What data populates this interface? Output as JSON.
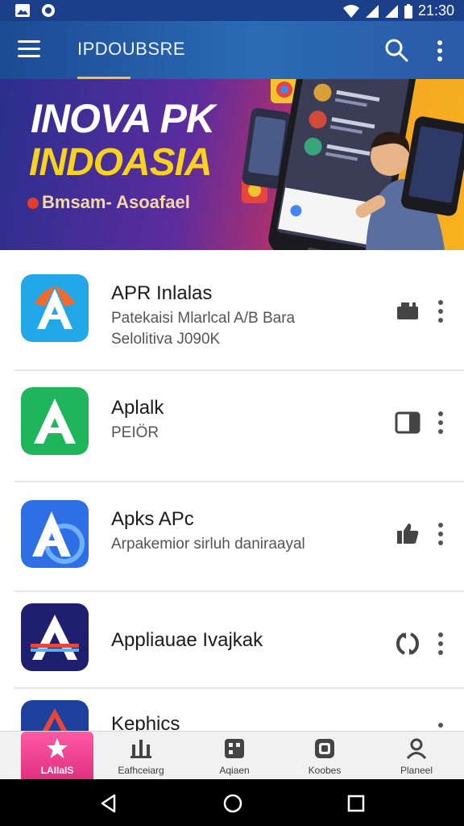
{
  "status_bar": {
    "time": "21:30",
    "icons": [
      "gallery-icon",
      "app-icon",
      "wifi-icon",
      "signal-icon",
      "signal-icon",
      "battery-icon"
    ]
  },
  "app_bar": {
    "title": "IPDOUBSRE",
    "icons": [
      "menu-icon",
      "search-icon",
      "more-vert-icon"
    ]
  },
  "banner": {
    "line1": "INOVA PK",
    "line2": "INDOASIA",
    "subtitle": "Bmsam- Asoafael"
  },
  "apps": [
    {
      "name": "APR Inlalas",
      "description": "Patekaisi Mlarlcal A/B Bara\nSelolitiva J090K",
      "icon_color": "#22a7e8",
      "action_icon": "cast-icon"
    },
    {
      "name": "Aplalk",
      "description": "PEIÖR",
      "icon_color": "#1fb55a",
      "action_icon": "tablet-icon"
    },
    {
      "name": "Apks APc",
      "description": "Arpakemior sirluh daniraayal",
      "icon_color": "#2f6fe6",
      "action_icon": "thumbs-up-icon"
    },
    {
      "name": "Appliauae Ivajkak",
      "description": "",
      "icon_color": "#1e1f6e",
      "action_icon": "sync-icon"
    },
    {
      "name": "Kephics",
      "description": "",
      "icon_color": "#1d3f9e",
      "action_icon": ""
    }
  ],
  "bottom_nav": [
    {
      "label": "LAIIaIS",
      "icon": "star-icon",
      "active": true
    },
    {
      "label": "Eafhceiarg",
      "icon": "building-icon",
      "active": false
    },
    {
      "label": "Aqiaen",
      "icon": "grid-icon",
      "active": false
    },
    {
      "label": "Koobes",
      "icon": "book-icon",
      "active": false
    },
    {
      "label": "Planeel",
      "icon": "person-icon",
      "active": false
    }
  ],
  "system_nav": [
    "back-icon",
    "home-icon",
    "recents-icon"
  ],
  "colors": {
    "status_bar": "#1c3f8a",
    "app_bar": "#2a6bb5",
    "accent_underline": "#f4c430",
    "banner_yellow": "#f7d21e",
    "active_nav": "#e0307f"
  }
}
